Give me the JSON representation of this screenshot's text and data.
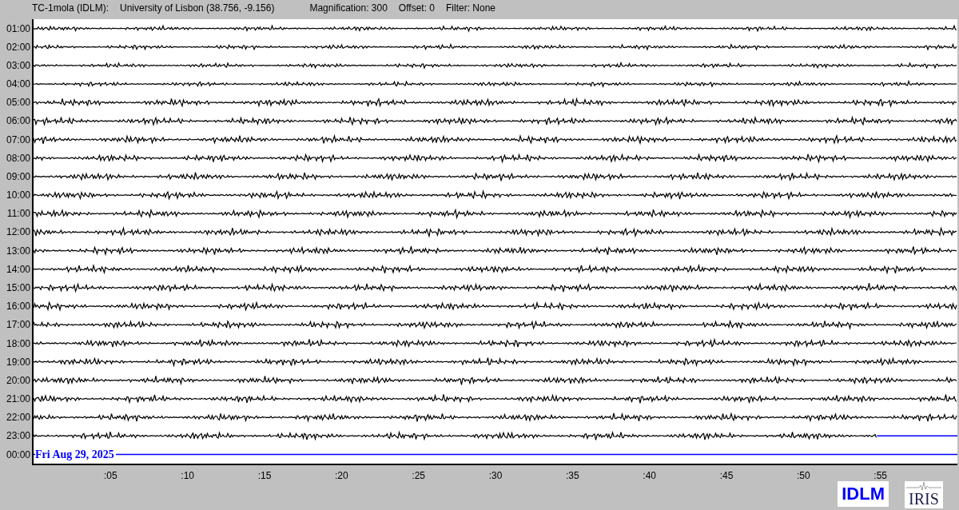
{
  "header": {
    "station": "TC-1mola (IDLM):",
    "location": "University of Lisbon (38.756, -9.156)",
    "magnification": "Magnification: 300",
    "offset": "Offset: 0",
    "filter": "Filter: None"
  },
  "helicorder": {
    "rows": [
      {
        "time": "01:00",
        "kind": "trace"
      },
      {
        "time": "02:00",
        "kind": "trace"
      },
      {
        "time": "03:00",
        "kind": "trace"
      },
      {
        "time": "04:00",
        "kind": "trace"
      },
      {
        "time": "05:00",
        "kind": "trace"
      },
      {
        "time": "06:00",
        "kind": "trace"
      },
      {
        "time": "07:00",
        "kind": "trace"
      },
      {
        "time": "08:00",
        "kind": "trace"
      },
      {
        "time": "09:00",
        "kind": "trace"
      },
      {
        "time": "10:00",
        "kind": "trace"
      },
      {
        "time": "11:00",
        "kind": "trace"
      },
      {
        "time": "12:00",
        "kind": "trace"
      },
      {
        "time": "13:00",
        "kind": "trace"
      },
      {
        "time": "14:00",
        "kind": "trace"
      },
      {
        "time": "15:00",
        "kind": "trace"
      },
      {
        "time": "16:00",
        "kind": "trace"
      },
      {
        "time": "17:00",
        "kind": "trace"
      },
      {
        "time": "18:00",
        "kind": "trace"
      },
      {
        "time": "19:00",
        "kind": "trace"
      },
      {
        "time": "20:00",
        "kind": "trace"
      },
      {
        "time": "21:00",
        "kind": "trace"
      },
      {
        "time": "22:00",
        "kind": "trace"
      },
      {
        "time": "23:00",
        "kind": "partial",
        "level": 0.913
      },
      {
        "time": "00:00",
        "kind": "empty"
      }
    ],
    "date": "Fri Aug 29, 2025",
    "x_ticks": [
      ":05",
      ":10",
      ":15",
      ":20",
      ":25",
      ":30",
      ":35",
      ":40",
      ":45",
      ":50",
      ":55"
    ]
  },
  "logos": {
    "idlm": "IDLM",
    "iris": "IRIS"
  }
}
